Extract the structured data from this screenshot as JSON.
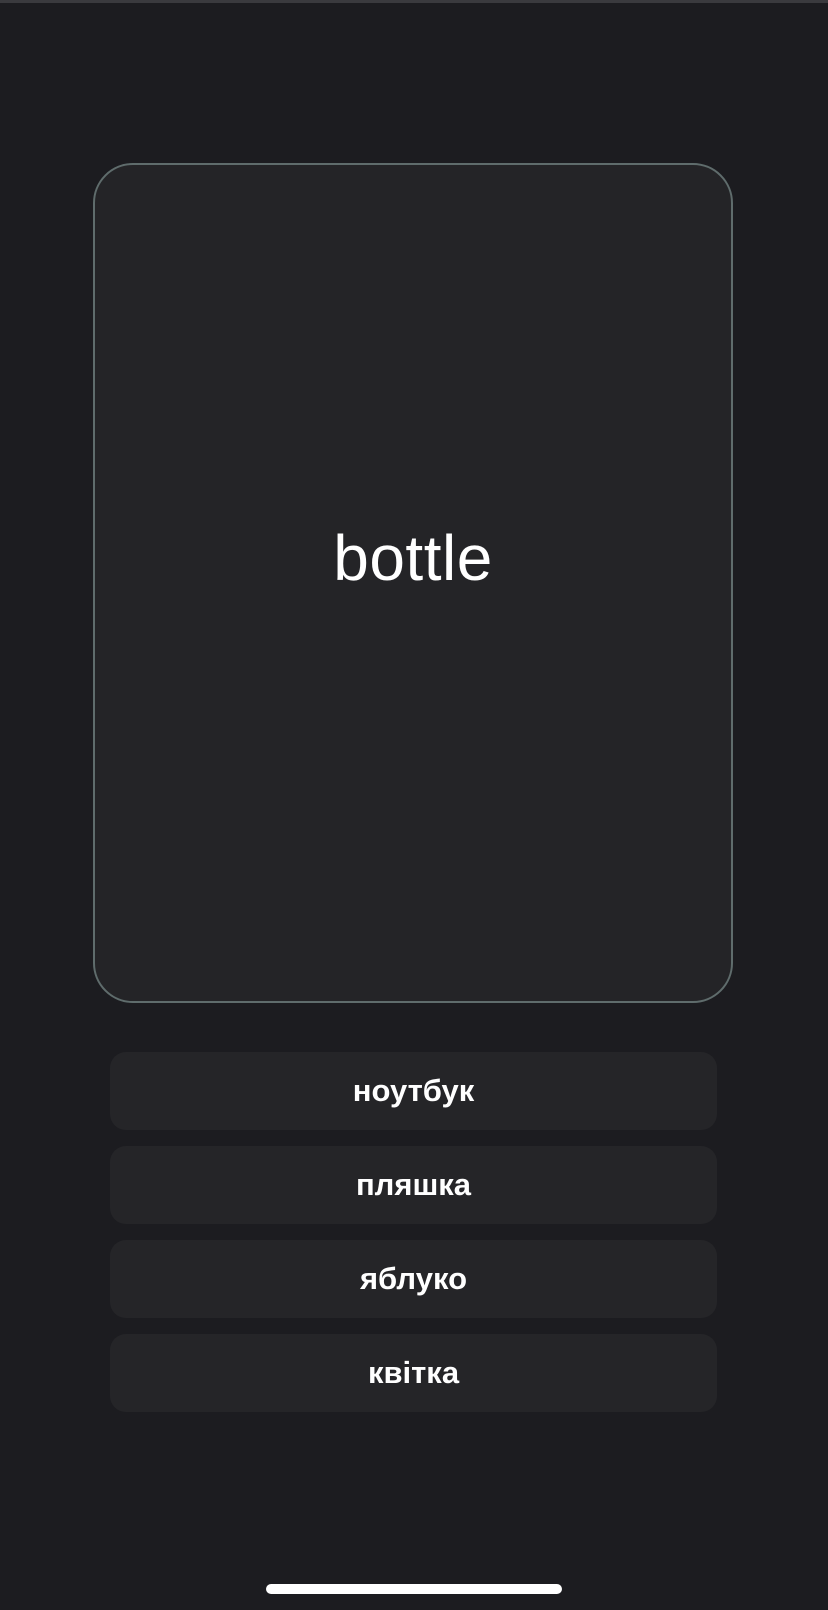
{
  "flashcard": {
    "word": "bottle"
  },
  "options": [
    {
      "label": "ноутбук"
    },
    {
      "label": "пляшка"
    },
    {
      "label": "яблуко"
    },
    {
      "label": "квітка"
    }
  ],
  "colors": {
    "background": "#1c1c20",
    "card_background": "#242427",
    "card_border": "#5f6c6c",
    "option_background": "#252528",
    "text": "#ffffff"
  }
}
